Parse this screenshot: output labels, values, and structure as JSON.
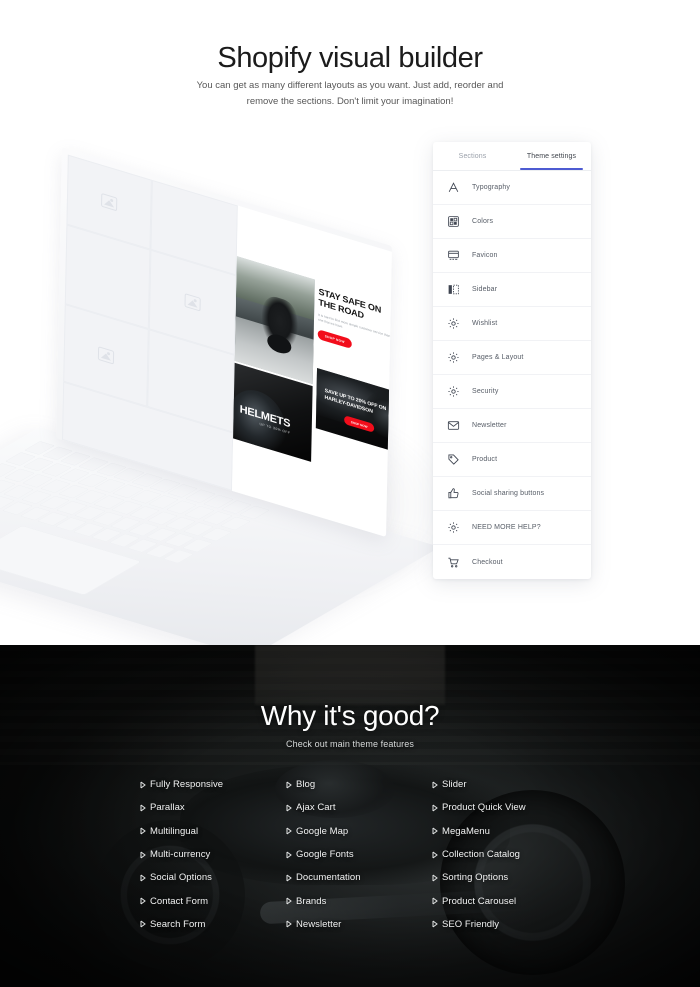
{
  "hero": {
    "title": "Shopify visual builder",
    "subtitle": "You can get as many different layouts as you want. Just add, reorder and remove the sections. Don't limit your imagination!"
  },
  "preview": {
    "hero_card": {
      "heading": "STAY SAFE ON THE ROAD",
      "body": "It is hard to find more simple customer service than the one that we have.",
      "button": "SHOP NOW"
    },
    "helmets_card": {
      "title": "HELMETS",
      "subtitle": "UP TO 30% OFF"
    },
    "promo_card": {
      "text": "SAVE UP TO 20% OFF ON HARLEY-DAVIDSON",
      "button": "SHOP NOW"
    }
  },
  "settings_panel": {
    "tabs": [
      {
        "label": "Sections",
        "active": false
      },
      {
        "label": "Theme settings",
        "active": true
      }
    ],
    "accent_color": "#4d5bd2",
    "items": [
      {
        "label": "Typography",
        "icon": "typography-icon"
      },
      {
        "label": "Colors",
        "icon": "colors-icon"
      },
      {
        "label": "Favicon",
        "icon": "favicon-icon"
      },
      {
        "label": "Sidebar",
        "icon": "sidebar-icon"
      },
      {
        "label": "Wishlist",
        "icon": "gear-icon"
      },
      {
        "label": "Pages & Layout",
        "icon": "gear-icon"
      },
      {
        "label": "Security",
        "icon": "gear-icon"
      },
      {
        "label": "Newsletter",
        "icon": "envelope-icon"
      },
      {
        "label": "Product",
        "icon": "tag-icon"
      },
      {
        "label": "Social sharing buttons",
        "icon": "thumbs-up-icon"
      },
      {
        "label": "NEED MORE HELP?",
        "icon": "gear-icon"
      },
      {
        "label": "Checkout",
        "icon": "cart-icon"
      }
    ]
  },
  "features_section": {
    "title": "Why it's good?",
    "subtitle": "Check out main theme features",
    "columns": [
      {
        "items": [
          "Fully Responsive",
          "Parallax",
          "Multilingual",
          "Multi-currency",
          "Social Options",
          "Contact Form",
          "Search Form"
        ]
      },
      {
        "items": [
          "Blog",
          "Ajax Cart",
          "Google Map",
          "Google Fonts",
          "Documentation",
          "Brands",
          "Newsletter"
        ]
      },
      {
        "items": [
          "Slider",
          "Product Quick View",
          "MegaMenu",
          "Collection Catalog",
          "Sorting Options",
          "Product Carousel",
          "SEO Friendly"
        ]
      }
    ]
  }
}
